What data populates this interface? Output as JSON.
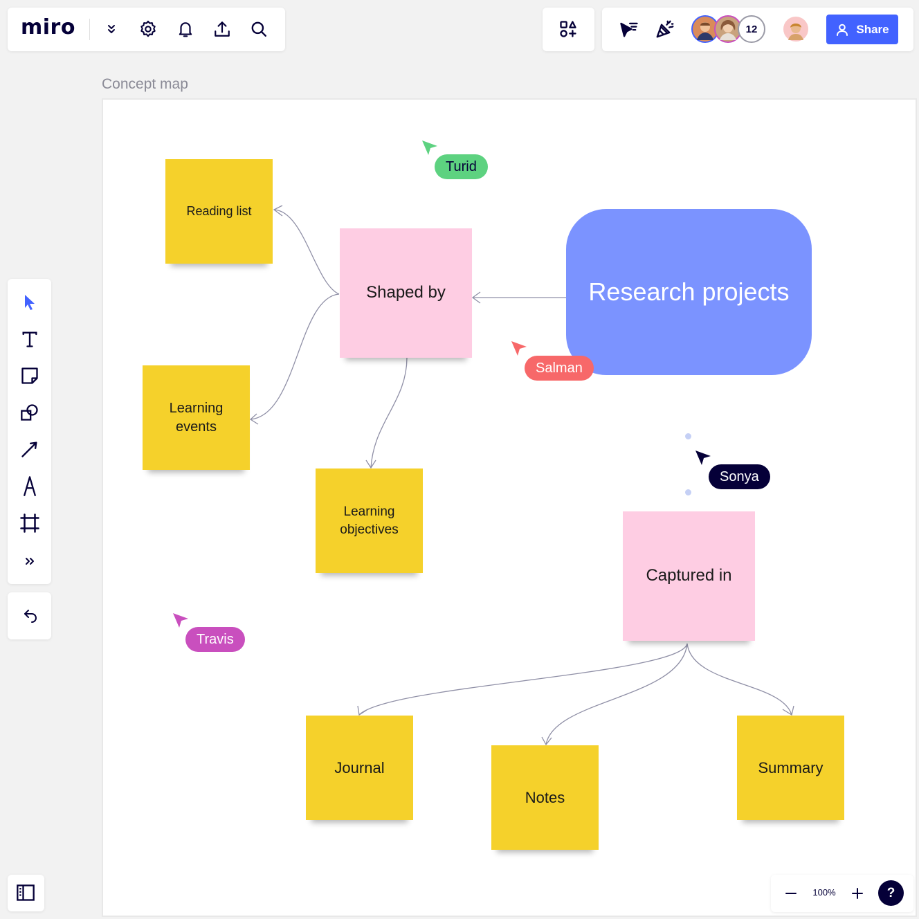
{
  "app": {
    "logo": "miro"
  },
  "board": {
    "title": "Concept map"
  },
  "nodes": {
    "reading_list": "Reading list",
    "shaped_by": "Shaped by",
    "research_projects": "Research projects",
    "learning_events": "Learning events",
    "learning_objectives": "Learning objectives",
    "captured_in": "Captured in",
    "journal": "Journal",
    "notes": "Notes",
    "summary": "Summary"
  },
  "collaborators": {
    "turid": {
      "name": "Turid",
      "color": "#5dd280"
    },
    "salman": {
      "name": "Salman",
      "color": "#f76869"
    },
    "sonya": {
      "name": "Sonya",
      "color": "#050038"
    },
    "travis": {
      "name": "Travis",
      "color": "#c94fbe"
    }
  },
  "header": {
    "avatar_count": "12",
    "share_label": "Share"
  },
  "toolbar": {
    "tools": [
      "select-icon",
      "text-icon",
      "sticky-note-icon",
      "shapes-icon",
      "arrow-icon",
      "pen-icon",
      "frame-icon",
      "more-icon"
    ],
    "undo": "undo-icon"
  },
  "zoom": {
    "level": "100%",
    "help": "?"
  },
  "colors": {
    "sticky_yellow": "#f5d12b",
    "sticky_pink": "#fecde3",
    "research_blue": "#7b93ff",
    "share_blue": "#4262ff"
  }
}
